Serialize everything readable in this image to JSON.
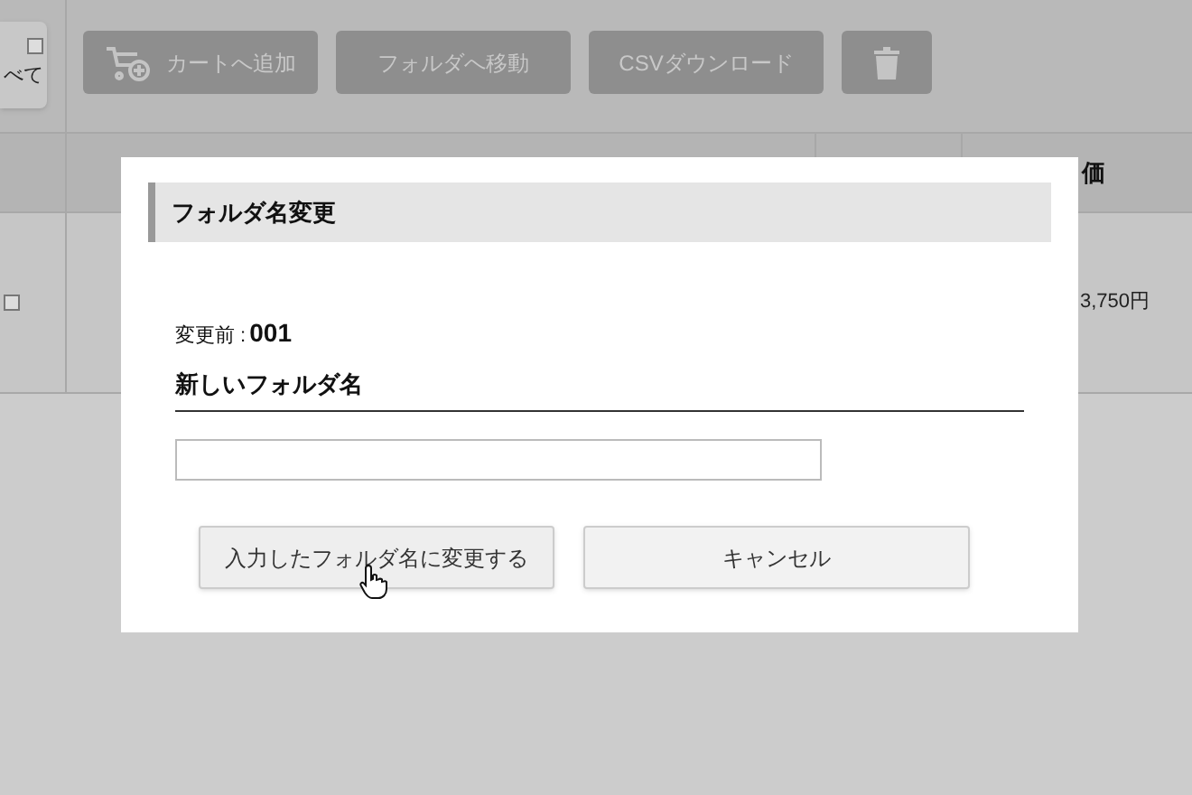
{
  "background": {
    "select_all_label": "べて",
    "select_all_checked": false,
    "toolbar": [
      {
        "kind": "cart",
        "label": "カートへ追加"
      },
      {
        "kind": "text",
        "label": "フォルダへ移動"
      },
      {
        "kind": "text",
        "label": "CSVダウンロード"
      },
      {
        "kind": "trash"
      }
    ],
    "table": {
      "header_price": "価",
      "row": {
        "checked": false,
        "price": "3,750円"
      }
    }
  },
  "dialog": {
    "title": "フォルダ名変更",
    "before_label": "変更前 :",
    "before_value": "001",
    "new_name_label": "新しいフォルダ名",
    "buttons": [
      {
        "label": "入力したフォルダ名に変更する",
        "hovered": true
      },
      {
        "label": "キャンセル",
        "hovered": false
      }
    ]
  }
}
